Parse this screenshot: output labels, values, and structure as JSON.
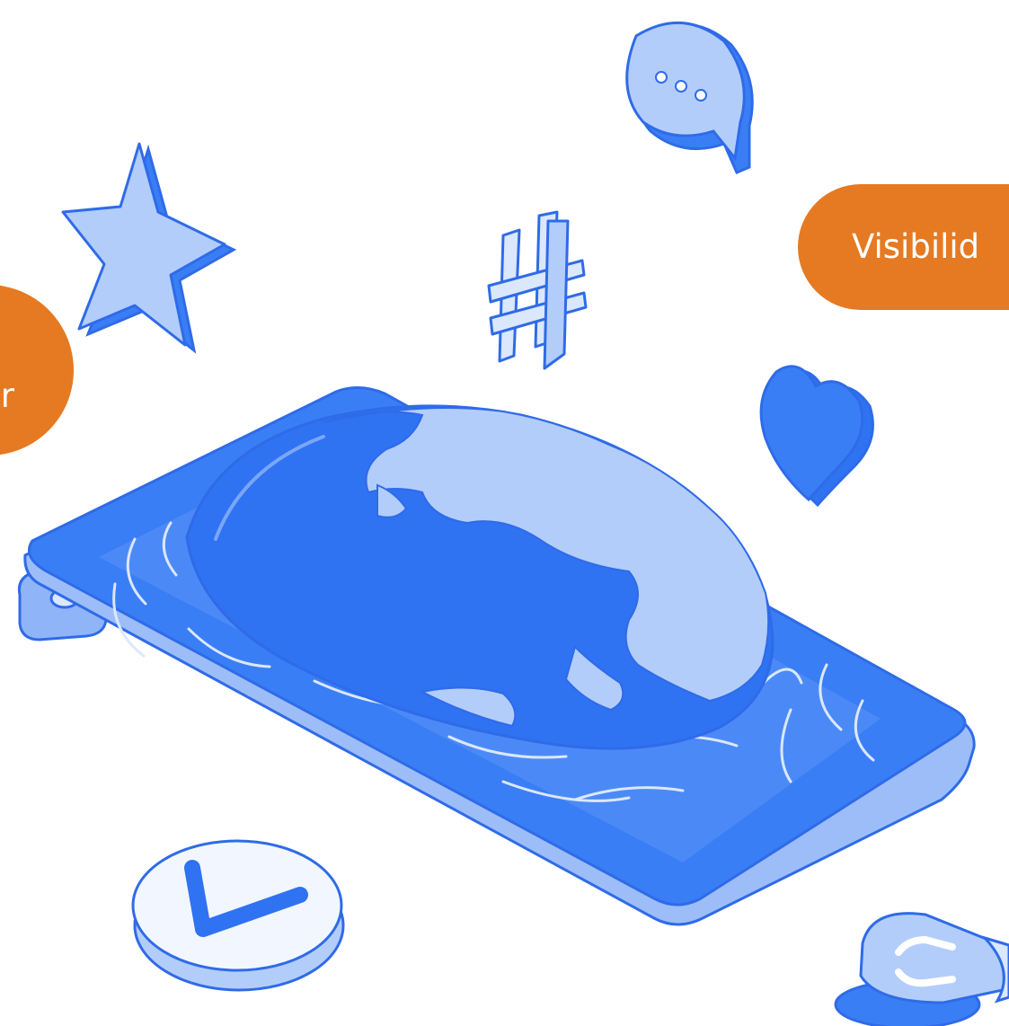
{
  "callouts": {
    "right_label": "Visibilid",
    "left_label": "r"
  },
  "colors": {
    "accent_orange": "#e57a22",
    "primary_blue": "#3a7ef5",
    "light_blue": "#b3cdfb",
    "pale_blue": "#dbe7fd",
    "stroke_blue": "#2f6be8",
    "background": "#ffffff"
  },
  "icons": [
    "star-icon",
    "speech-bubble-icon",
    "hashtag-icon",
    "heart-icon",
    "globe-icon",
    "smartphone-icon",
    "checkmark-icon",
    "lightbulb-icon"
  ]
}
